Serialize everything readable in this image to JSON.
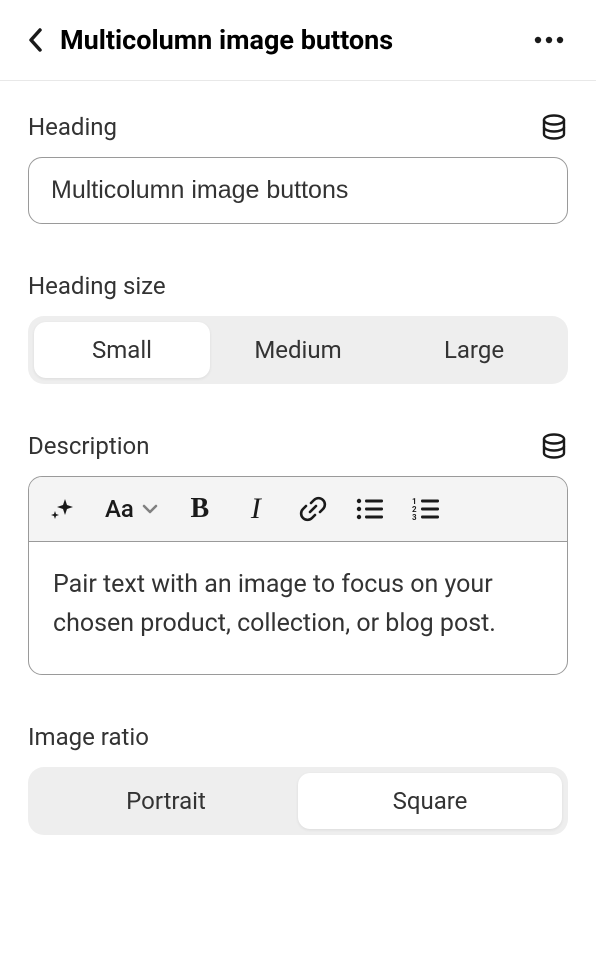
{
  "header": {
    "title": "Multicolumn image buttons"
  },
  "heading": {
    "label": "Heading",
    "value": "Multicolumn image buttons"
  },
  "heading_size": {
    "label": "Heading size",
    "options": [
      "Small",
      "Medium",
      "Large"
    ],
    "selected": "Small"
  },
  "description": {
    "label": "Description",
    "value": "Pair text with an image to focus on your chosen product, collection, or blog post."
  },
  "image_ratio": {
    "label": "Image ratio",
    "options": [
      "Portrait",
      "Square"
    ],
    "selected": "Square"
  },
  "toolbar": {
    "aa": "Aa"
  }
}
